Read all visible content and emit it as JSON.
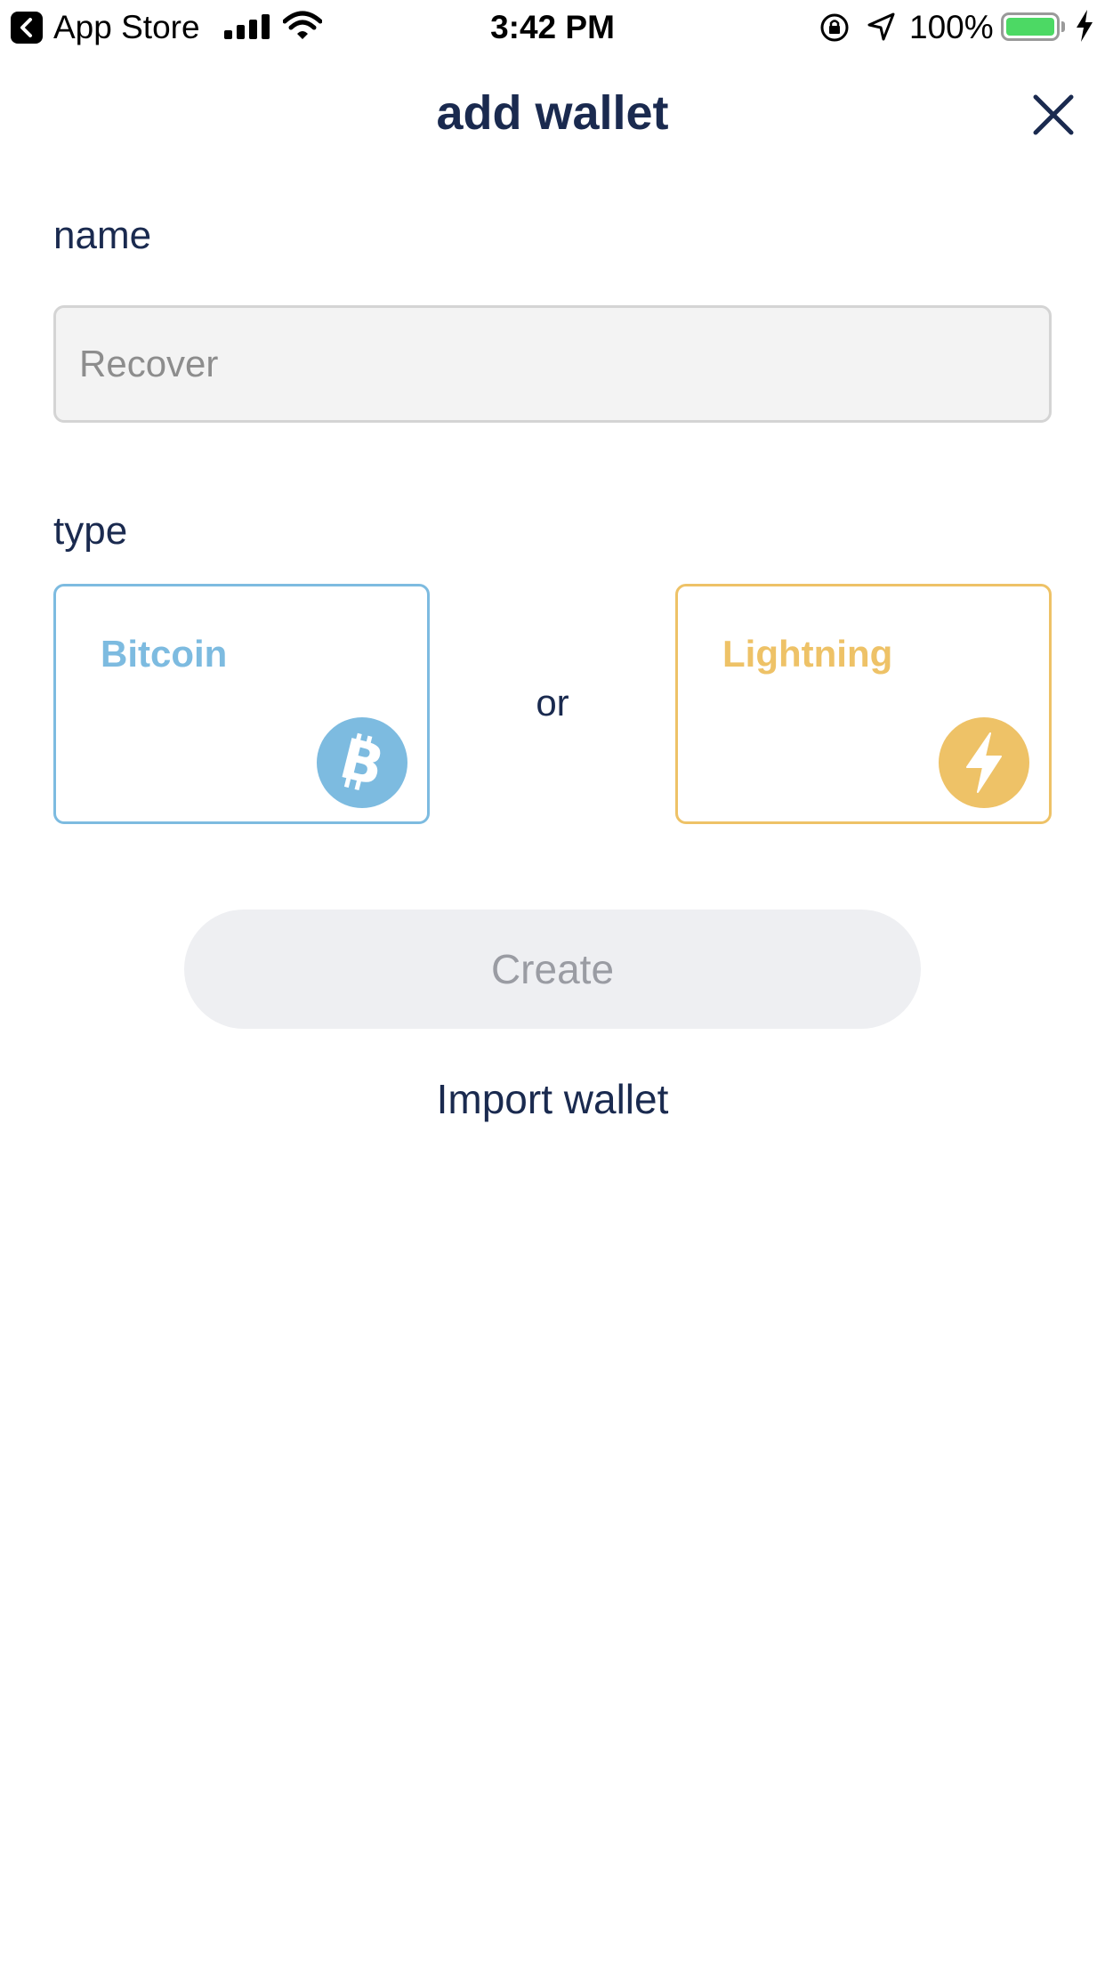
{
  "status_bar": {
    "back_app": "App Store",
    "time": "3:42 PM",
    "battery": "100%"
  },
  "header": {
    "title": "add wallet"
  },
  "form": {
    "name_label": "name",
    "name_placeholder": "Recover",
    "type_label": "type",
    "types": [
      {
        "label": "Bitcoin",
        "icon": "bitcoin-icon",
        "color": "#7dbbe0"
      },
      {
        "label": "Lightning",
        "icon": "lightning-icon",
        "color": "#eec267"
      }
    ],
    "or_text": "or",
    "create_label": "Create",
    "import_label": "Import wallet"
  }
}
